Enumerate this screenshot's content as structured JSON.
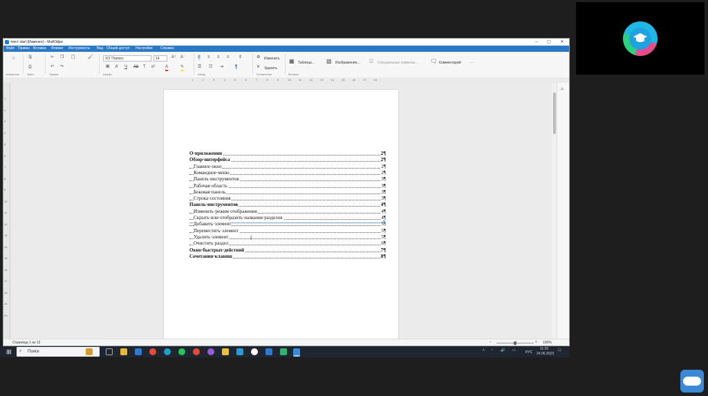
{
  "window": {
    "title": "текст start [Изменен] – МойОфис",
    "controls": [
      "–",
      "▢",
      "✕"
    ]
  },
  "menu": [
    "Файл",
    "Правка",
    "Вставка",
    "Формат",
    "Инструменты",
    "Вид",
    "Общий доступ",
    "Настройки",
    "Справка"
  ],
  "toolbar": {
    "groups": [
      "Избранное",
      "Файл",
      "Правка",
      "Шрифт",
      "Абзац",
      "Оглавление",
      "Вставка"
    ],
    "font_name": "XO Thames",
    "font_size": "14",
    "change_label": "Изменить",
    "delete_label": "Удалить",
    "table_label": "Таблица...",
    "image_label": "Изображение...",
    "special_chars_label": "Специальные символы...",
    "comment_label": "Комментарий",
    "more_label": "···"
  },
  "ruler": {
    "marks": [
      "1",
      "2",
      "3",
      "4",
      "5",
      "6",
      "7",
      "8",
      "9",
      "10",
      "11",
      "12",
      "13",
      "14",
      "15",
      "16",
      "17",
      "18"
    ]
  },
  "vruler": {
    "marks": [
      "1",
      "2",
      "3",
      "4",
      "5",
      "6",
      "7",
      "8",
      "9",
      "10",
      "11",
      "12",
      "13",
      "14",
      "15",
      "16",
      "17",
      "18",
      "19",
      "20"
    ]
  },
  "toc": [
    {
      "label": "О·приложении",
      "page": "2¶",
      "level": 0
    },
    {
      "label": "Обзор·интерфейса",
      "page": "2¶",
      "level": 0
    },
    {
      "label": "Главное·окно",
      "page": "2¶",
      "level": 1
    },
    {
      "label": "Командное·меню",
      "page": "2¶",
      "level": 1
    },
    {
      "label": "Панель·инструментов",
      "page": "3¶",
      "level": 1
    },
    {
      "label": "Рабочая·область",
      "page": "3¶",
      "level": 1
    },
    {
      "label": "Боковая·панель",
      "page": "3¶",
      "level": 1
    },
    {
      "label": "Строка·состояния",
      "page": "3¶",
      "level": 1
    },
    {
      "label": "Панель·инструментов",
      "page": "4¶",
      "level": 0
    },
    {
      "label": "Изменить·режим·отображения",
      "page": "4¶",
      "level": 1
    },
    {
      "label": "Скрыть·или·отобразить·названия·разделов",
      "page": "4¶",
      "level": 1
    },
    {
      "label": "Добавить·элемент",
      "page": "5¶",
      "level": 1
    },
    {
      "label": "Переместить·элемент",
      "page": "5¶",
      "level": 1
    },
    {
      "label": "Удалить·элемент",
      "page": "5¶",
      "level": 1
    },
    {
      "label": "Очистить·раздел",
      "page": "6¶",
      "level": 1
    },
    {
      "label": "Окно·быстрых·действий",
      "page": "7¶",
      "level": 0
    },
    {
      "label": "Сочетания·клавиш",
      "page": "8¶",
      "level": 0
    }
  ],
  "page_end_mark": "¶",
  "status": {
    "page_info": "Страница 1 из 12",
    "zoom": "100%",
    "zoom_level": 100
  },
  "taskbar": {
    "search_placeholder": "Поиск",
    "time": "11:20",
    "date": "24.06.2023",
    "lang": "РУС"
  }
}
